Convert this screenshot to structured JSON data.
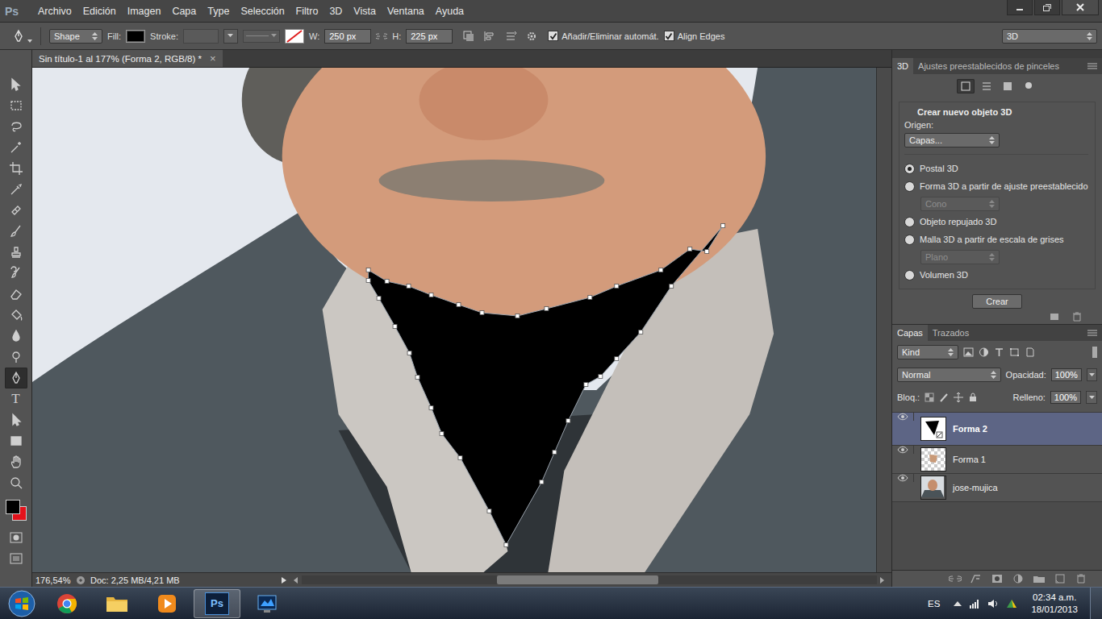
{
  "app": {
    "logo": "Ps"
  },
  "menu": [
    "Archivo",
    "Edición",
    "Imagen",
    "Capa",
    "Type",
    "Selección",
    "Filtro",
    "3D",
    "Vista",
    "Ventana",
    "Ayuda"
  ],
  "options_bar": {
    "mode": "Shape",
    "fill_label": "Fill:",
    "fill_color": "#000000",
    "stroke_label": "Stroke:",
    "w_label": "W:",
    "w_value": "250 px",
    "h_label": "H:",
    "h_value": "225 px",
    "checkboxes": [
      {
        "label": "Añadir/Eliminar automát.",
        "checked": true
      },
      {
        "label": "Align Edges",
        "checked": true
      }
    ],
    "workspace": "3D"
  },
  "document_tab": {
    "title": "Sin título-1 al 177% (Forma 2, RGB/8) *",
    "close": "×"
  },
  "tools": [
    {
      "selected": false
    },
    {
      "selected": false
    },
    {
      "selected": false
    },
    {
      "selected": false
    },
    {
      "selected": false
    },
    {
      "selected": false
    },
    {
      "selected": false
    },
    {
      "selected": false
    },
    {
      "selected": false
    },
    {
      "selected": false
    },
    {
      "selected": false
    },
    {
      "selected": false
    },
    {
      "selected": false
    },
    {
      "selected": false
    },
    {
      "selected": true
    },
    {
      "selected": false,
      "glyph": "T"
    },
    {
      "selected": false
    },
    {
      "selected": false
    },
    {
      "selected": false
    },
    {
      "selected": false
    }
  ],
  "colors": {
    "foreground": "#000000",
    "background": "#e3121b"
  },
  "status_bar": {
    "zoom": "176,54%",
    "doc": "Doc: 2,25 MB/4,21 MB"
  },
  "scrollbar": {
    "offset": 0.34,
    "size": 0.28
  },
  "panel_3d": {
    "tabs": [
      {
        "label": "3D",
        "selected": true
      },
      {
        "label": "Ajustes preestablecidos de pinceles",
        "selected": false
      }
    ],
    "view_buttons": [
      {
        "selected": true
      },
      {
        "selected": false
      },
      {
        "selected": false
      },
      {
        "selected": false
      }
    ],
    "heading": "Crear nuevo objeto 3D",
    "source_label": "Origen:",
    "source": "Capas...",
    "options": [
      {
        "label": "Postal 3D",
        "selected": true
      },
      {
        "label": "Forma 3D a partir de ajuste preestablecido",
        "selected": false,
        "preset": {
          "label": "Cono",
          "disabled": true
        }
      },
      {
        "label": "Objeto repujado 3D",
        "selected": false
      },
      {
        "label": "Malla 3D a partir de escala de grises",
        "selected": false,
        "preset": {
          "label": "Plano",
          "disabled": true
        }
      },
      {
        "label": "Volumen 3D",
        "selected": false
      }
    ],
    "button": "Crear"
  },
  "layers_panel": {
    "tabs": [
      {
        "label": "Capas",
        "selected": true
      },
      {
        "label": "Trazados",
        "selected": false
      }
    ],
    "filter": "Kind",
    "blend_mode": "Normal",
    "opacity_label": "Opacidad:",
    "opacity": "100%",
    "lock_label": "Bloq.:",
    "fill_label": "Relleno:",
    "fill": "100%",
    "layers": [
      {
        "name": "Forma 2",
        "visible": true,
        "selected": true,
        "kind": "shape"
      },
      {
        "name": "Forma 1",
        "visible": true,
        "selected": false,
        "kind": "patch"
      },
      {
        "name": "jose-mujica",
        "visible": true,
        "selected": false,
        "kind": "photo"
      }
    ]
  },
  "taskbar": {
    "apps": [
      {
        "kind": "chrome",
        "active": false
      },
      {
        "kind": "explorer",
        "active": false
      },
      {
        "kind": "media",
        "active": false
      },
      {
        "kind": "photoshop",
        "active": true,
        "label": "Ps"
      },
      {
        "kind": "other",
        "active": false
      }
    ],
    "language": "ES",
    "time": "02:34 a.m.",
    "date": "18/01/2013"
  }
}
